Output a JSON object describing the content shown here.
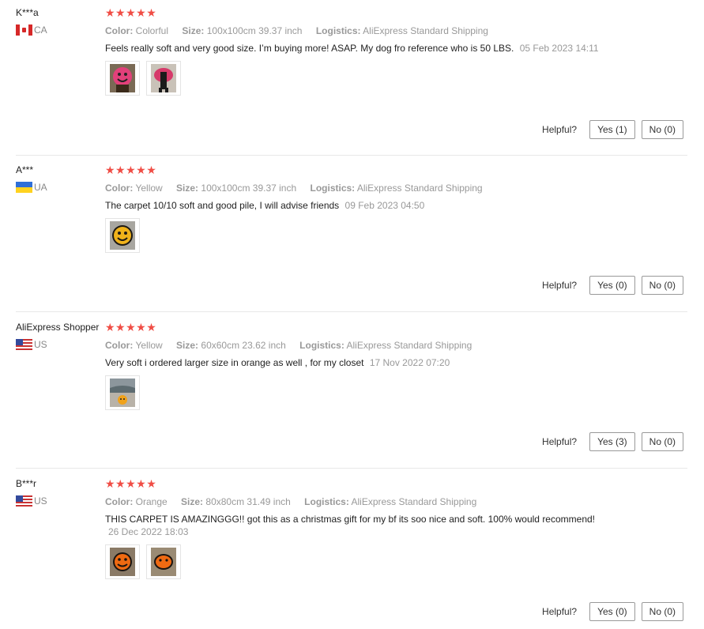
{
  "reviews": [
    {
      "user": "K***a",
      "country": "CA",
      "flag": "canada-flag-icon",
      "stars": "★★★★★",
      "color_label": "Color:",
      "color": "Colorful",
      "size_label": "Size:",
      "size": "100x100cm 39.37 inch",
      "logistics_label": "Logistics:",
      "logistics": "AliExpress Standard Shipping",
      "text": "Feels really soft and very good size. I’m buying more! ASAP. My dog fro reference who is 50 LBS.",
      "date": "05 Feb 2023 14:11",
      "helpful_label": "Helpful?",
      "yes": "Yes (1)",
      "no": "No (0)"
    },
    {
      "user": "A***",
      "country": "UA",
      "flag": "ukraine-flag-icon",
      "stars": "★★★★★",
      "color_label": "Color:",
      "color": "Yellow",
      "size_label": "Size:",
      "size": "100x100cm 39.37 inch",
      "logistics_label": "Logistics:",
      "logistics": "AliExpress Standard Shipping",
      "text": "The carpet 10/10 soft and good pile, I will advise friends",
      "date": "09 Feb 2023 04:50",
      "helpful_label": "Helpful?",
      "yes": "Yes (0)",
      "no": "No (0)"
    },
    {
      "user": "AliExpress Shopper",
      "country": "US",
      "flag": "usa-flag-icon",
      "stars": "★★★★★",
      "color_label": "Color:",
      "color": "Yellow",
      "size_label": "Size:",
      "size": "60x60cm 23.62 inch",
      "logistics_label": "Logistics:",
      "logistics": "AliExpress Standard Shipping",
      "text": "Very soft i ordered larger size in orange as well , for my closet",
      "date": "17 Nov 2022 07:20",
      "helpful_label": "Helpful?",
      "yes": "Yes (3)",
      "no": "No (0)"
    },
    {
      "user": "B***r",
      "country": "US",
      "flag": "usa-flag-icon",
      "stars": "★★★★★",
      "color_label": "Color:",
      "color": "Orange",
      "size_label": "Size:",
      "size": "80x80cm 31.49 inch",
      "logistics_label": "Logistics:",
      "logistics": "AliExpress Standard Shipping",
      "text": "THIS CARPET IS AMAZINGGG!! got this as a christmas gift for my bf its soo nice and soft. 100% would recommend!",
      "date": "26 Dec 2022 18:03",
      "helpful_label": "Helpful?",
      "yes": "Yes (0)",
      "no": "No (0)"
    }
  ],
  "colors": {
    "star": "#f04d45",
    "meta": "#999999",
    "border": "#e8e8e8"
  }
}
